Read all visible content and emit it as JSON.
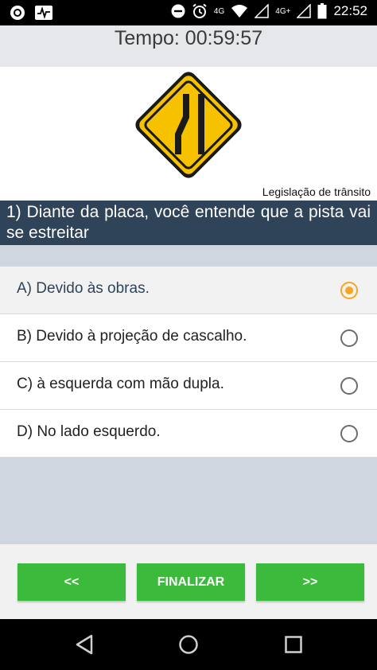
{
  "status_bar": {
    "time": "22:52",
    "network_4g": "4G",
    "network_4gplus": "4G+",
    "icons": [
      "app-icon",
      "pulse-icon",
      "dnd-icon",
      "alarm-icon",
      "wifi-icon",
      "signal-icon",
      "battery-icon"
    ]
  },
  "timer": {
    "text": "Tempo: 00:59:57"
  },
  "sign": {
    "icon": "road-narrows-left-sign-icon",
    "colors": {
      "fill": "#f6c200",
      "border": "#1a1a1a"
    }
  },
  "category": "Legislação de trânsito",
  "question": {
    "text": "1) Diante da placa, você entende que a pista vai se estreitar"
  },
  "options": [
    {
      "label": "A) Devido às obras.",
      "selected": true
    },
    {
      "label": "B) Devido à projeção de cascalho.",
      "selected": false
    },
    {
      "label": "C) à esquerda com mão dupla.",
      "selected": false
    },
    {
      "label": "D) No lado esquerdo.",
      "selected": false
    }
  ],
  "buttons": {
    "prev": "<<",
    "finish": "FINALIZAR",
    "next": ">>"
  },
  "colors": {
    "accent_green": "#3cba3c",
    "question_bg": "#2f4359",
    "radio_selected": "#f5a623"
  },
  "nav": {
    "icons": [
      "back-icon",
      "home-icon",
      "recents-icon"
    ]
  }
}
